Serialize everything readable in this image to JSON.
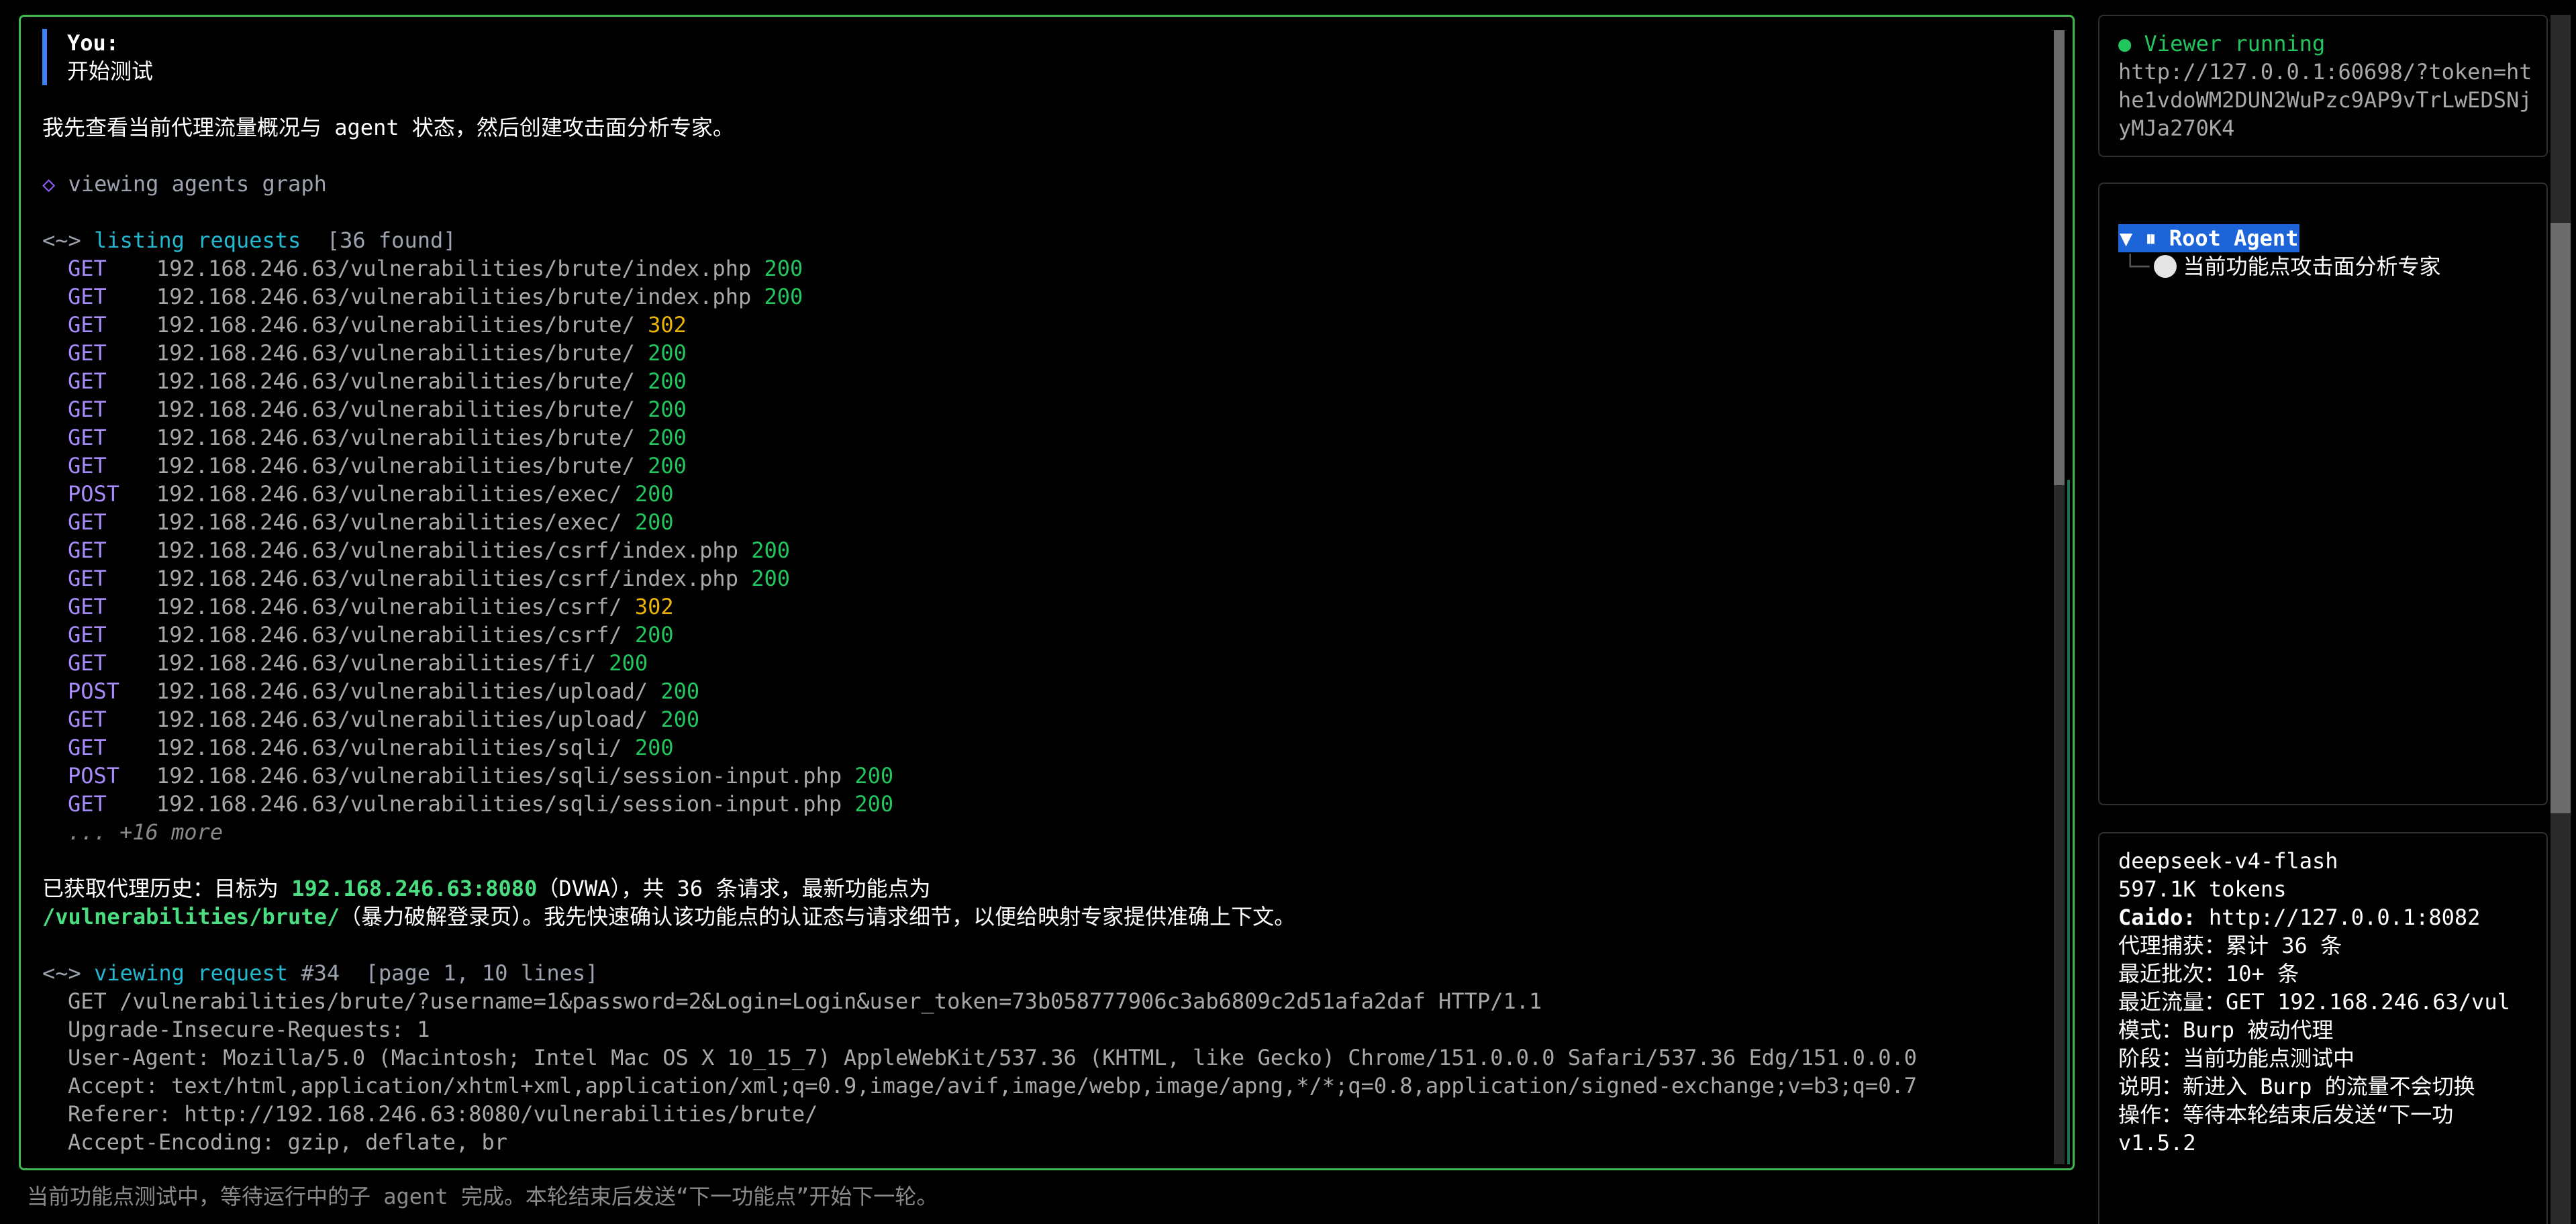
{
  "conversation": {
    "you_label": "You:",
    "you_text": "开始测试",
    "intro": "我先查看当前代理流量概况与 agent 状态，然后创建攻击面分析专家。",
    "tool1": {
      "icon": "◇",
      "name": "viewing agents graph"
    },
    "tool2": {
      "wave": "<~>",
      "name": "listing requests",
      "meta": "[36 found]"
    },
    "requests": [
      {
        "method": "GET",
        "url": "192.168.246.63/vulnerabilities/brute/index.php",
        "status": "200"
      },
      {
        "method": "GET",
        "url": "192.168.246.63/vulnerabilities/brute/index.php",
        "status": "200"
      },
      {
        "method": "GET",
        "url": "192.168.246.63/vulnerabilities/brute/",
        "status": "302"
      },
      {
        "method": "GET",
        "url": "192.168.246.63/vulnerabilities/brute/",
        "status": "200"
      },
      {
        "method": "GET",
        "url": "192.168.246.63/vulnerabilities/brute/",
        "status": "200"
      },
      {
        "method": "GET",
        "url": "192.168.246.63/vulnerabilities/brute/",
        "status": "200"
      },
      {
        "method": "GET",
        "url": "192.168.246.63/vulnerabilities/brute/",
        "status": "200"
      },
      {
        "method": "GET",
        "url": "192.168.246.63/vulnerabilities/brute/",
        "status": "200"
      },
      {
        "method": "POST",
        "url": "192.168.246.63/vulnerabilities/exec/",
        "status": "200"
      },
      {
        "method": "GET",
        "url": "192.168.246.63/vulnerabilities/exec/",
        "status": "200"
      },
      {
        "method": "GET",
        "url": "192.168.246.63/vulnerabilities/csrf/index.php",
        "status": "200"
      },
      {
        "method": "GET",
        "url": "192.168.246.63/vulnerabilities/csrf/index.php",
        "status": "200"
      },
      {
        "method": "GET",
        "url": "192.168.246.63/vulnerabilities/csrf/",
        "status": "302"
      },
      {
        "method": "GET",
        "url": "192.168.246.63/vulnerabilities/csrf/",
        "status": "200"
      },
      {
        "method": "GET",
        "url": "192.168.246.63/vulnerabilities/fi/",
        "status": "200"
      },
      {
        "method": "POST",
        "url": "192.168.246.63/vulnerabilities/upload/",
        "status": "200"
      },
      {
        "method": "GET",
        "url": "192.168.246.63/vulnerabilities/upload/",
        "status": "200"
      },
      {
        "method": "GET",
        "url": "192.168.246.63/vulnerabilities/sqli/",
        "status": "200"
      },
      {
        "method": "POST",
        "url": "192.168.246.63/vulnerabilities/sqli/session-input.php",
        "status": "200"
      },
      {
        "method": "GET",
        "url": "192.168.246.63/vulnerabilities/sqli/session-input.php",
        "status": "200"
      }
    ],
    "more": "... +16 more",
    "summary": {
      "p1": "已获取代理历史：目标为 ",
      "target": "192.168.246.63:8080",
      "p2": "（DVWA），共 36 条请求，最新功能点为",
      "path": "/vulnerabilities/brute/",
      "p3": "（暴力破解登录页）。我先快速确认该功能点的认证态与请求细节，以便给映射专家提供准确上下文。"
    },
    "tool3": {
      "wave": "<~>",
      "name": "viewing request",
      "id": "#34",
      "meta": "[page 1, 10 lines]"
    },
    "request_lines": [
      "GET /vulnerabilities/brute/?username=1&password=2&Login=Login&user_token=73b058777906c3ab6809c2d51afa2daf HTTP/1.1",
      "Upgrade-Insecure-Requests: 1",
      "User-Agent: Mozilla/5.0 (Macintosh; Intel Mac OS X 10_15_7) AppleWebKit/537.36 (KHTML, like Gecko) Chrome/151.0.0.0 Safari/537.36 Edg/151.0.0.0",
      "Accept: text/html,application/xhtml+xml,application/xml;q=0.9,image/avif,image/webp,image/apng,*/*;q=0.8,application/signed-exchange;v=b3;q=0.7",
      "Referer: http://192.168.246.63:8080/vulnerabilities/brute/",
      "Accept-Encoding: gzip, deflate, br"
    ]
  },
  "status_bar": "当前功能点测试中，等待运行中的子 agent 完成。本轮结束后发送“下一功能点”开始下一轮。",
  "viewer": {
    "dot": "●",
    "status": "Viewer running",
    "url": "http://127.0.0.1:60698/?token=hthe1vdoWM2DUN2WuPzc9AP9vTrLwEDSNjyMJa270K4"
  },
  "tree": {
    "root": "▼ ⏸ Root Agent",
    "branch": "└─",
    "child": "当前功能点攻击面分析专家"
  },
  "info": {
    "model": "deepseek-v4-flash",
    "tokens": "597.1K tokens",
    "caido_label": "Caido:",
    "caido_value": " http://127.0.0.1:8082",
    "proxy": "代理捕获：累计 36 条",
    "batch": "最近批次：10+ 条",
    "recent": "最近流量：GET 192.168.246.63/vul",
    "mode": "模式：Burp 被动代理",
    "stage": "阶段：当前功能点测试中",
    "note": "说明：新进入 Burp 的流量不会切换",
    "action": "操作：等待本轮结束后发送“下一功",
    "version": "v1.5.2"
  },
  "colors": {
    "accent_green": "#3fb950",
    "status_200": "#22c55e",
    "status_302": "#eab308",
    "method": "#a78bfa",
    "tool_cyan": "#22b8cf",
    "user_bar": "#3b82f6",
    "tree_highlight": "#1d64d8"
  }
}
